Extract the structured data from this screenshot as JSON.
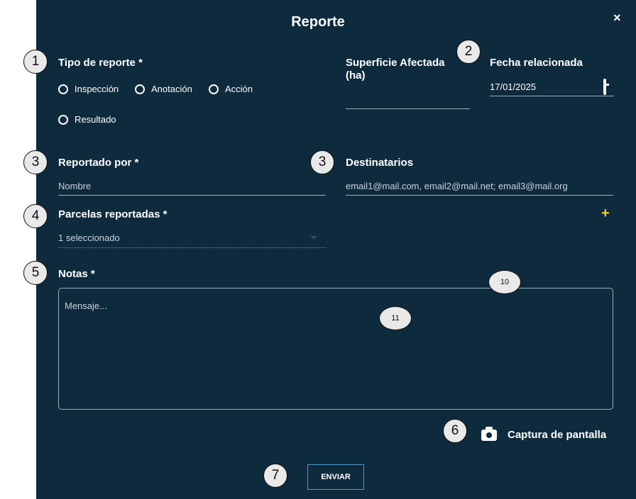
{
  "dialog": {
    "title": "Reporte",
    "close_label": "×"
  },
  "report_type": {
    "label": "Tipo de reporte *",
    "options": [
      "Inspección",
      "Anotación",
      "Acción",
      "Resultado"
    ]
  },
  "area": {
    "label_line1": "Superficie Afectada",
    "label_line2": "(ha)",
    "value": ""
  },
  "date": {
    "label": "Fecha relacionada",
    "value": "17/01/2025"
  },
  "reported_by": {
    "label": "Reportado por *",
    "placeholder": "Nombre"
  },
  "recipients": {
    "label": "Destinatarios",
    "placeholder": "email1@mail.com, email2@mail.net; email3@mail.org"
  },
  "parcels": {
    "label": "Parcelas reportadas *",
    "selected": "1 seleccionado",
    "add_label": "+"
  },
  "notes": {
    "label": "Notas *",
    "placeholder": "Mensaje..."
  },
  "screenshot": {
    "label": "Captura de pantalla"
  },
  "submit": {
    "label": "ENVIAR"
  },
  "annotations": [
    "1",
    "2",
    "3",
    "3",
    "4",
    "5",
    "6",
    "7",
    "10",
    "11"
  ],
  "colors": {
    "background": "#0e2a3d",
    "accent_plus": "#f2d21a",
    "button_border": "#4a9bc9"
  }
}
